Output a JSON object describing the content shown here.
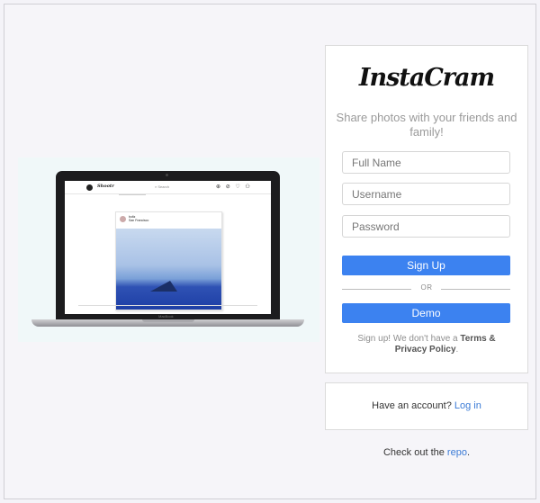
{
  "hero": {
    "mini_brand": "Shootr",
    "mini_search": "⌕ Search",
    "mini_icons": "⊕ ⊘ ♡ ⚇",
    "mini_user": "boltz",
    "mini_location": "San Francisco",
    "laptop_label": "MacBook"
  },
  "signup": {
    "logo": "InstaCram",
    "tagline": "Share photos with your friends and family!",
    "full_name_placeholder": "Full Name",
    "username_placeholder": "Username",
    "password_placeholder": "Password",
    "signup_button": "Sign Up",
    "divider": "OR",
    "demo_button": "Demo",
    "terms_prefix": "Sign up! We don't have a ",
    "terms_bold": "Terms & Privacy Policy",
    "terms_suffix": "."
  },
  "login": {
    "prompt": "Have an account? ",
    "link": "Log in"
  },
  "footer": {
    "prefix": "Check out the ",
    "link": "repo",
    "suffix": "."
  },
  "colors": {
    "accent": "#3c82f0",
    "link": "#3b7bd6",
    "background": "#f6f5f9"
  }
}
